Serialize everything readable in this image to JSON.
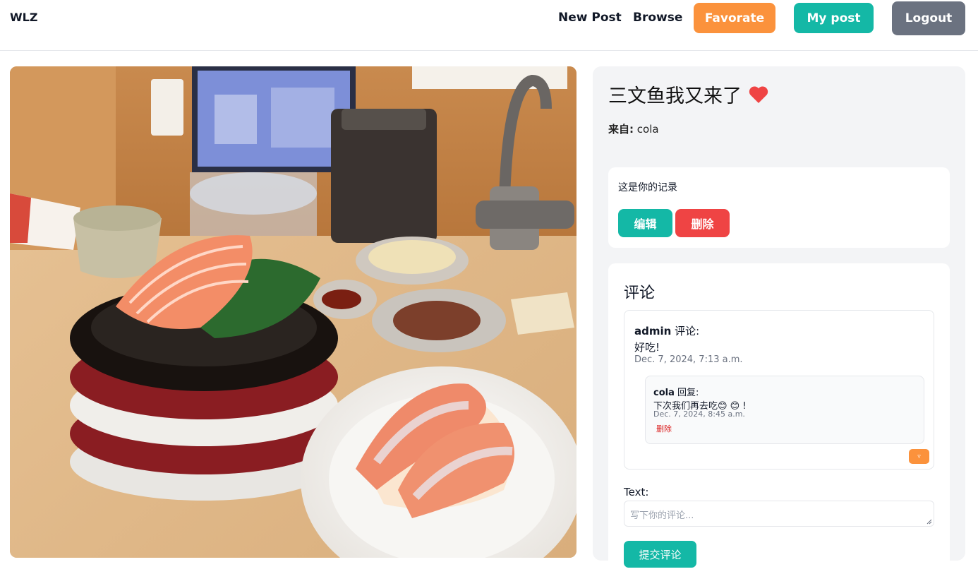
{
  "nav": {
    "brand": "WLZ",
    "new_post": "New Post",
    "browse": "Browse",
    "favorite": "Favorate",
    "my_post": "My post",
    "logout": "Logout"
  },
  "post": {
    "title": "三文鱼我又来了",
    "from_label": "来自:",
    "author": "cola",
    "image_icon": "food-photo"
  },
  "owner": {
    "notice": "这是你的记录",
    "edit": "编辑",
    "delete": "删除"
  },
  "comments": {
    "heading": "评论",
    "items": [
      {
        "author": "admin",
        "verb": "评论:",
        "text": "好吃!",
        "date": "Dec. 7, 2024, 7:13 a.m.",
        "replies": [
          {
            "author": "cola",
            "verb": "回复:",
            "text": "下次我们再去吃😊 😊 !",
            "date": "Dec. 7, 2024, 8:45 a.m.",
            "delete": "删除"
          }
        ],
        "toggle": "▿"
      }
    ],
    "form": {
      "label": "Text:",
      "placeholder": "写下你的评论...",
      "submit": "提交评论"
    }
  },
  "colors": {
    "favorite": "#fb923c",
    "my_post": "#14b8a6",
    "logout": "#6b7280",
    "edit": "#14b8a6",
    "delete": "#ef4444",
    "heart": "#ef4444"
  }
}
